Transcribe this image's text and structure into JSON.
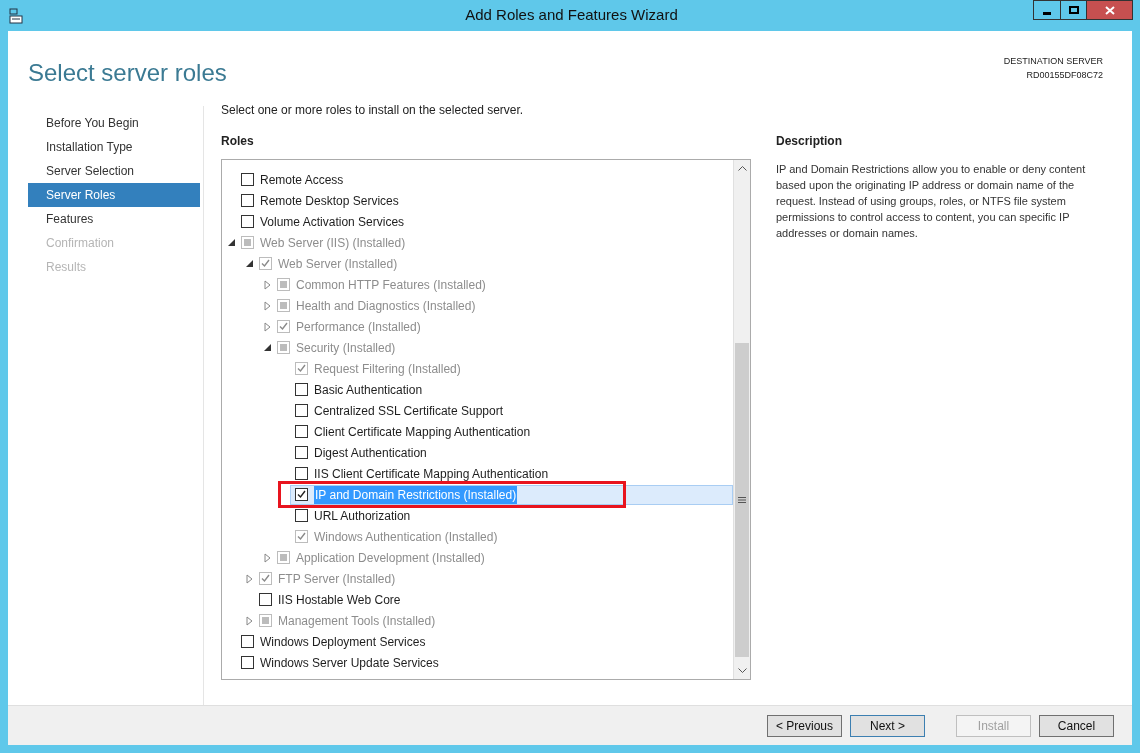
{
  "window": {
    "title": "Add Roles and Features Wizard"
  },
  "page_title": "Select server roles",
  "destination": {
    "label": "DESTINATION SERVER",
    "server": "RD00155DF08C72"
  },
  "steps": [
    {
      "label": "Before You Begin",
      "selected": false,
      "disabled": false
    },
    {
      "label": "Installation Type",
      "selected": false,
      "disabled": false
    },
    {
      "label": "Server Selection",
      "selected": false,
      "disabled": false
    },
    {
      "label": "Server Roles",
      "selected": true,
      "disabled": false
    },
    {
      "label": "Features",
      "selected": false,
      "disabled": false
    },
    {
      "label": "Confirmation",
      "selected": false,
      "disabled": true
    },
    {
      "label": "Results",
      "selected": false,
      "disabled": true
    }
  ],
  "instruction": "Select one or more roles to install on the selected server.",
  "roles": {
    "heading": "Roles",
    "items": [
      {
        "label": "Remote Access",
        "checked": false,
        "partial": false,
        "disabled": false,
        "selected": false
      },
      {
        "label": "Remote Desktop Services",
        "checked": false,
        "partial": false,
        "disabled": false,
        "selected": false
      },
      {
        "label": "Volume Activation Services",
        "checked": false,
        "partial": false,
        "disabled": false,
        "selected": false
      },
      {
        "label": "Web Server (IIS) (Installed)",
        "checked": false,
        "partial": true,
        "disabled": true,
        "selected": false,
        "expanded": true,
        "children": [
          {
            "label": "Web Server (Installed)",
            "checked": true,
            "partial": false,
            "disabled": true,
            "selected": false,
            "expanded": true,
            "children": [
              {
                "label": "Common HTTP Features (Installed)",
                "checked": false,
                "partial": true,
                "disabled": true,
                "selected": false,
                "expanded": false
              },
              {
                "label": "Health and Diagnostics (Installed)",
                "checked": false,
                "partial": true,
                "disabled": true,
                "selected": false,
                "expanded": false
              },
              {
                "label": "Performance (Installed)",
                "checked": true,
                "partial": false,
                "disabled": true,
                "selected": false,
                "expanded": false
              },
              {
                "label": "Security (Installed)",
                "checked": false,
                "partial": true,
                "disabled": true,
                "selected": false,
                "expanded": true,
                "children": [
                  {
                    "label": "Request Filtering (Installed)",
                    "checked": true,
                    "partial": false,
                    "disabled": true,
                    "selected": false
                  },
                  {
                    "label": "Basic Authentication",
                    "checked": false,
                    "partial": false,
                    "disabled": false,
                    "selected": false
                  },
                  {
                    "label": "Centralized SSL Certificate Support",
                    "checked": false,
                    "partial": false,
                    "disabled": false,
                    "selected": false
                  },
                  {
                    "label": "Client Certificate Mapping Authentication",
                    "checked": false,
                    "partial": false,
                    "disabled": false,
                    "selected": false
                  },
                  {
                    "label": "Digest Authentication",
                    "checked": false,
                    "partial": false,
                    "disabled": false,
                    "selected": false
                  },
                  {
                    "label": "IIS Client Certificate Mapping Authentication",
                    "checked": false,
                    "partial": false,
                    "disabled": false,
                    "selected": false
                  },
                  {
                    "label": "IP and Domain Restrictions (Installed)",
                    "checked": true,
                    "partial": false,
                    "disabled": false,
                    "selected": true,
                    "highlighted": true
                  },
                  {
                    "label": "URL Authorization",
                    "checked": false,
                    "partial": false,
                    "disabled": false,
                    "selected": false
                  },
                  {
                    "label": "Windows Authentication (Installed)",
                    "checked": true,
                    "partial": false,
                    "disabled": true,
                    "selected": false
                  }
                ]
              },
              {
                "label": "Application Development (Installed)",
                "checked": false,
                "partial": true,
                "disabled": true,
                "selected": false,
                "expanded": false
              }
            ]
          },
          {
            "label": "FTP Server (Installed)",
            "checked": true,
            "partial": false,
            "disabled": true,
            "selected": false,
            "expanded": false
          },
          {
            "label": "IIS Hostable Web Core",
            "checked": false,
            "partial": false,
            "disabled": false,
            "selected": false
          },
          {
            "label": "Management Tools (Installed)",
            "checked": false,
            "partial": true,
            "disabled": true,
            "selected": false,
            "expanded": false
          }
        ]
      },
      {
        "label": "Windows Deployment Services",
        "checked": false,
        "partial": false,
        "disabled": false,
        "selected": false
      },
      {
        "label": "Windows Server Update Services",
        "checked": false,
        "partial": false,
        "disabled": false,
        "selected": false
      }
    ]
  },
  "description": {
    "heading": "Description",
    "text": "IP and Domain Restrictions allow you to enable or deny content based upon the originating IP address or domain name of the request. Instead of using groups, roles, or NTFS file system permissions to control access to content, you can specific IP addresses or domain names."
  },
  "buttons": [
    {
      "label": "< Previous",
      "disabled": false,
      "default": false
    },
    {
      "label": "Next >",
      "disabled": false,
      "default": true
    },
    {
      "label": "Install",
      "disabled": true,
      "default": false
    },
    {
      "label": "Cancel",
      "disabled": false,
      "default": false
    }
  ]
}
